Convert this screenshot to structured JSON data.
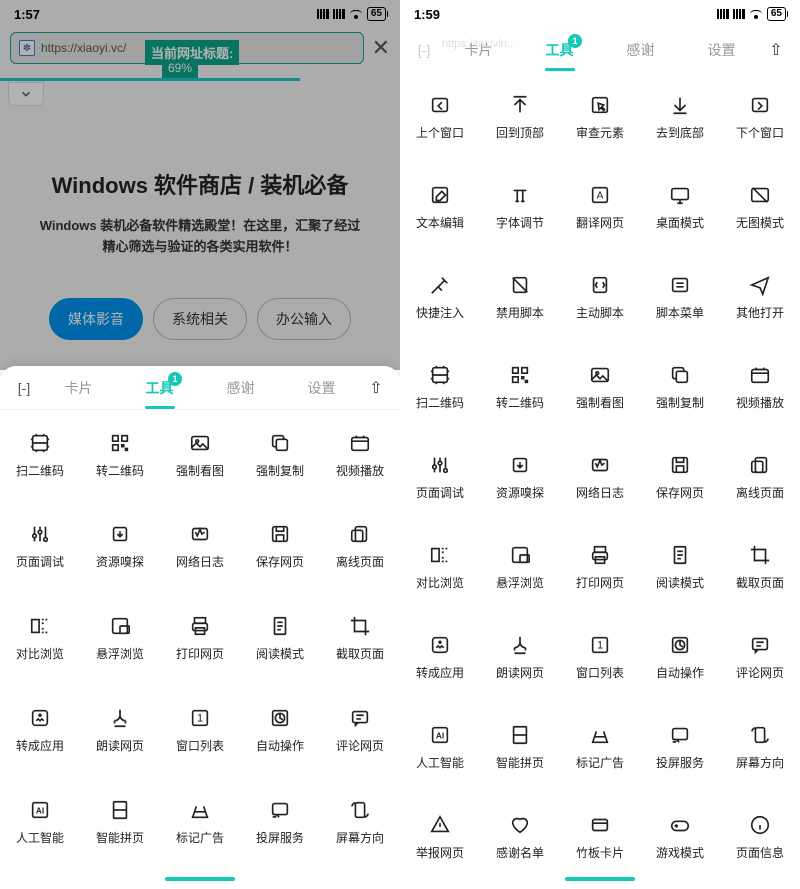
{
  "left": {
    "status": {
      "time": "1:57",
      "battery": "65"
    },
    "address": {
      "url": "https://xiaoyi.vc/"
    },
    "titleOverlay": "当前网址标题:",
    "progressText": "69%",
    "page": {
      "title": "Windows 软件商店 / 装机必备",
      "desc1": "Windows 装机必备软件精选殿堂！在这里，汇聚了经过",
      "desc2": "精心筛选与验证的各类实用软件！",
      "pills": [
        "媒体影音",
        "系统相关",
        "办公输入"
      ]
    },
    "tabs": [
      "卡片",
      "工具",
      "感谢",
      "设置"
    ],
    "badge": "1",
    "grid": [
      "扫二维码",
      "转二维码",
      "强制看图",
      "强制复制",
      "视频播放",
      "页面调试",
      "资源嗅探",
      "网络日志",
      "保存网页",
      "离线页面",
      "对比浏览",
      "悬浮浏览",
      "打印网页",
      "阅读模式",
      "截取页面",
      "转成应用",
      "朗读网页",
      "窗口列表",
      "自动操作",
      "评论网页",
      "人工智能",
      "智能拼页",
      "标记广告",
      "投屏服务",
      "屏幕方向"
    ]
  },
  "right": {
    "status": {
      "time": "1:59",
      "battery": "65"
    },
    "addressHint": "https://tac/vin...",
    "tabs": [
      "卡片",
      "工具",
      "感谢",
      "设置"
    ],
    "badge": "1",
    "grid": [
      "上个窗口",
      "回到顶部",
      "审查元素",
      "去到底部",
      "下个窗口",
      "文本编辑",
      "字体调节",
      "翻译网页",
      "桌面模式",
      "无图模式",
      "快捷注入",
      "禁用脚本",
      "主动脚本",
      "脚本菜单",
      "其他打开",
      "扫二维码",
      "转二维码",
      "强制看图",
      "强制复制",
      "视频播放",
      "页面调试",
      "资源嗅探",
      "网络日志",
      "保存网页",
      "离线页面",
      "对比浏览",
      "悬浮浏览",
      "打印网页",
      "阅读模式",
      "截取页面",
      "转成应用",
      "朗读网页",
      "窗口列表",
      "自动操作",
      "评论网页",
      "人工智能",
      "智能拼页",
      "标记广告",
      "投屏服务",
      "屏幕方向",
      "举报网页",
      "感谢名单",
      "竹板卡片",
      "游戏模式",
      "页面信息"
    ]
  }
}
